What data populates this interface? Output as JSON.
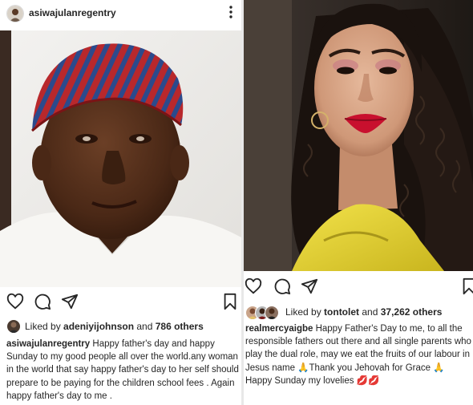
{
  "left_post": {
    "username": "asiwajulanregentry",
    "likes": {
      "prefix": "Liked by ",
      "user": "adeniyijohnson",
      "middle": " and ",
      "count": "786 others"
    },
    "caption": {
      "user": "asiwajulanregentry",
      "text": " Happy father's day and happy Sunday to my good people all over the world.any woman in the world that say happy father's day to her self should prepare to be paying for the children school fees . Again happy father's day to me ."
    },
    "icons": [
      "heart-icon",
      "comment-icon",
      "share-icon",
      "bookmark-icon",
      "more-icon"
    ]
  },
  "right_post": {
    "likes": {
      "prefix": "Liked by ",
      "user": "tontolet",
      "middle": " and ",
      "count": "37,262 others"
    },
    "caption": {
      "user": "realmercyaigbe",
      "text": " Happy Father's Day to me, to all the responsible fathers out there and all single parents who play the dual role, may we eat the fruits of our labour in Jesus name 🙏Thank you Jehovah for Grace 🙏",
      "line2": "Happy Sunday my lovelies 💋💋"
    },
    "icons": [
      "heart-icon",
      "comment-icon",
      "share-icon",
      "bookmark-icon"
    ]
  },
  "colors": {
    "cap_red": "#b8282c",
    "cap_blue": "#2c4a8c",
    "lip_red": "#c8102e"
  }
}
